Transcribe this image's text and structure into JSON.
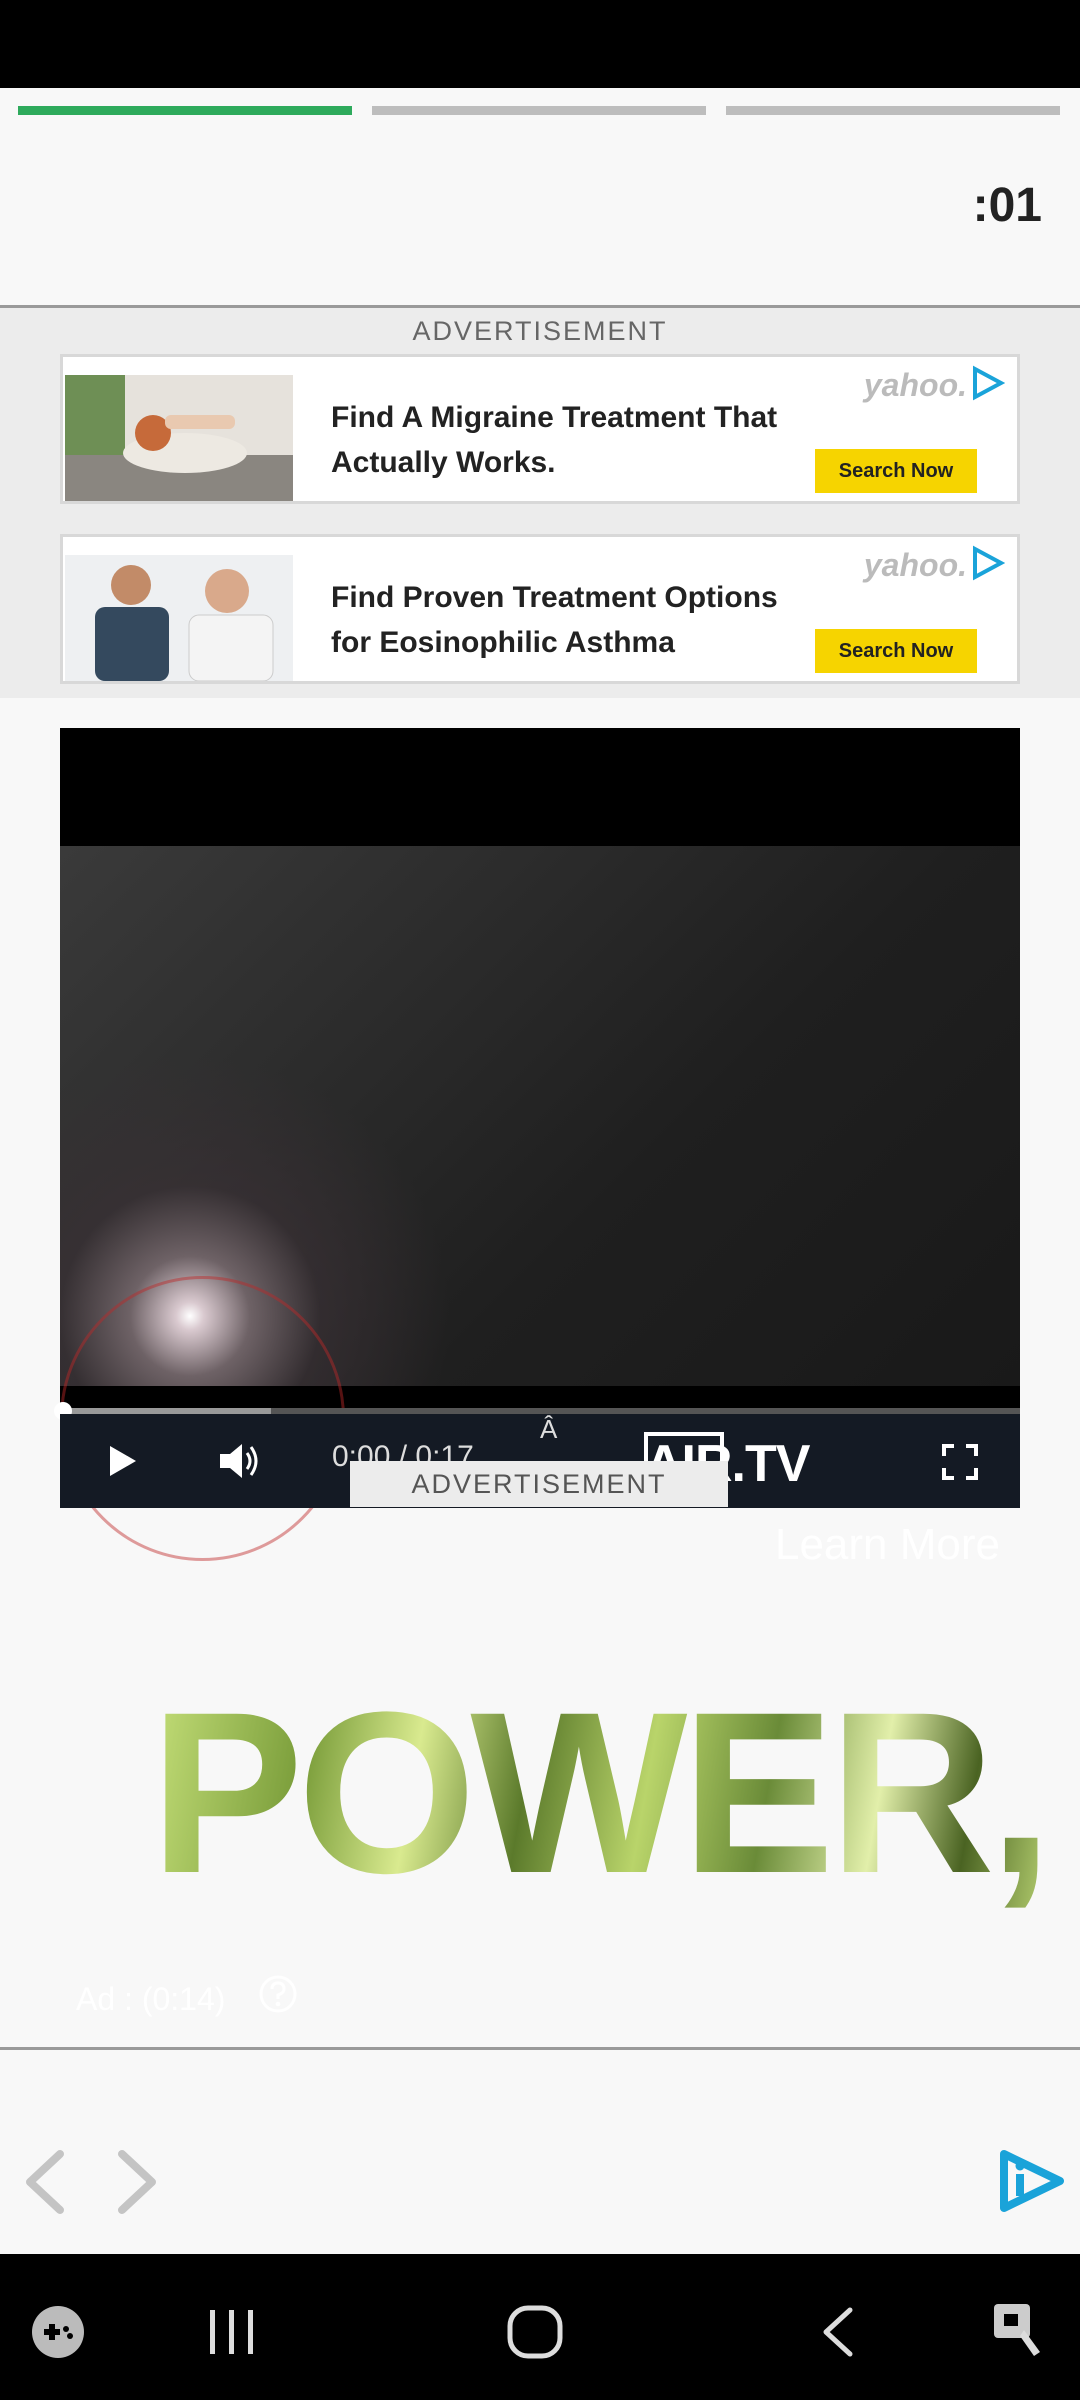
{
  "timer": ":01",
  "progress": {
    "segments": 3,
    "active": 1
  },
  "ads": {
    "label": "ADVERTISEMENT",
    "items": [
      {
        "headline_line1": "Find A Migraine Treatment That",
        "headline_line2": "Actually Works.",
        "brand": "yahoo.",
        "button": "Search Now"
      },
      {
        "headline_line1": "Find Proven Treatment Options",
        "headline_line2": "for Eosinophilic Asthma",
        "brand": "yahoo.",
        "button": "Search Now"
      }
    ]
  },
  "video": {
    "time": "0:00 / 0:17",
    "glyph": "Â",
    "logo": "AIR.TV",
    "overlay_label": "ADVERTISEMENT",
    "learn_more": "Learn More",
    "headline": "POWER,",
    "ad_countdown": "Ad : (0:14)",
    "progress_fraction": 0.22
  },
  "colors": {
    "accent": "#2eaa5c",
    "ad_button": "#f6d400",
    "brand_icon": "#1aa3d9"
  },
  "icons": [
    "play-icon",
    "volume-icon",
    "fullscreen-icon",
    "help-icon",
    "back-arrow-icon",
    "forward-arrow-icon",
    "app-logo-icon",
    "game-icon",
    "recents-icon",
    "home-icon",
    "nav-back-icon",
    "accessibility-icon"
  ]
}
